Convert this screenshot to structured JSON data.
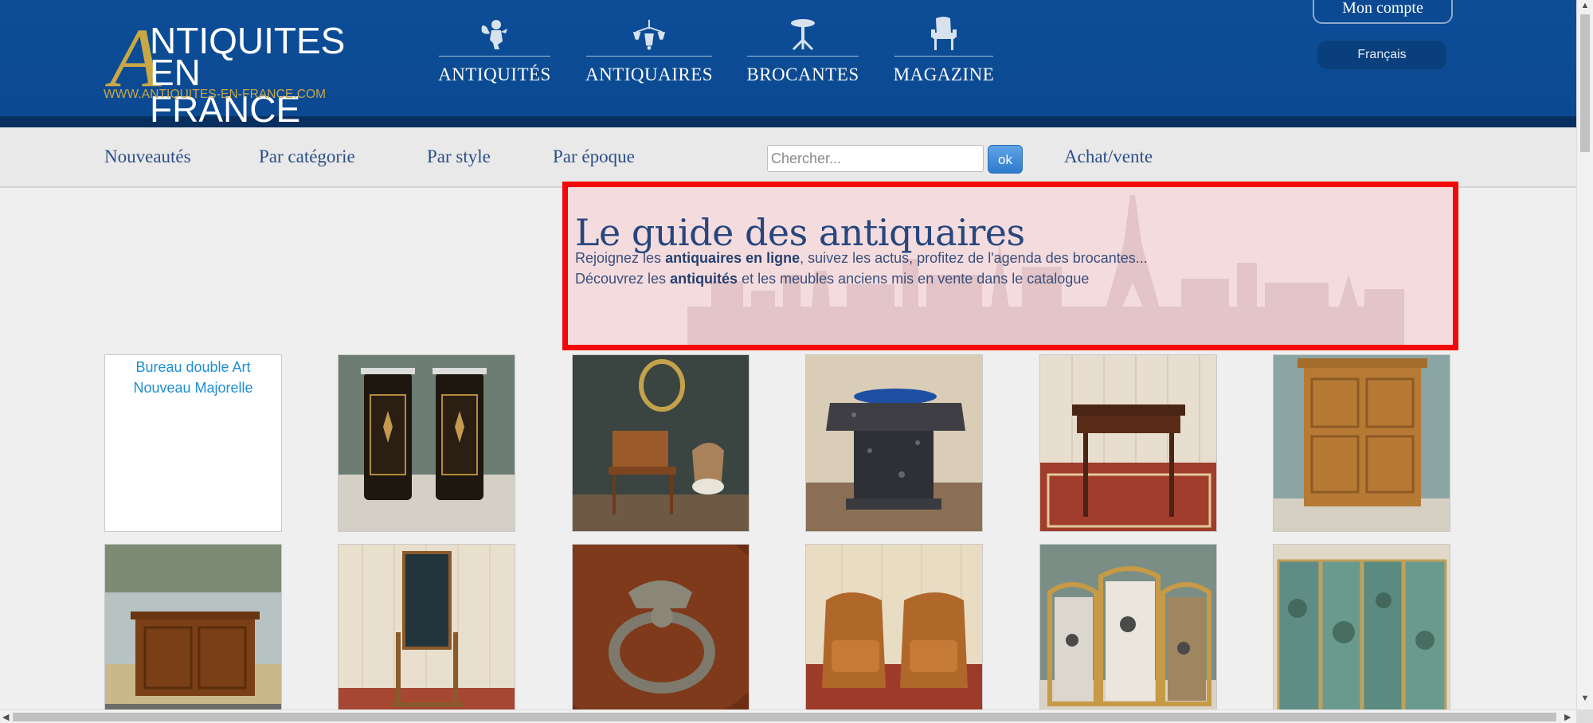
{
  "header": {
    "logo": {
      "line1": "NTIQUITES",
      "letter": "A",
      "line2": "EN FRANCE",
      "url": "WWW.ANTIQUITES-EN-FRANCE.COM"
    },
    "main_nav": [
      {
        "label": "ANTIQUITÉS",
        "icon": "cherub-icon"
      },
      {
        "label": "ANTIQUAIRES",
        "icon": "chandelier-icon"
      },
      {
        "label": "BROCANTES",
        "icon": "gueridon-table-icon"
      },
      {
        "label": "MAGAZINE",
        "icon": "armchair-icon"
      }
    ],
    "account_label": "Mon compte",
    "language": "Français"
  },
  "subnav": {
    "links": [
      "Nouveautés",
      "Par catégorie",
      "Par style",
      "Par époque"
    ],
    "search_placeholder": "Chercher...",
    "search_button": "ok",
    "achat_vente": "Achat/vente"
  },
  "hero": {
    "title": "Le guide des antiquaires",
    "line1_pre": "Rejoignez les ",
    "line1_bold": "antiquaires en ligne",
    "line1_post": ", suivez les actus, profitez de l'agenda des brocantes...",
    "line2_pre": "Découvrez les ",
    "line2_bold": "antiquités",
    "line2_post": " et les meubles anciens mis en vente dans le catalogue",
    "highlight_color": "#f20808"
  },
  "products": [
    {
      "alt": "Bureau double Art Nouveau Majorelle",
      "broken": true
    },
    {
      "subject": "pair of napoleon III marquetry cabinets"
    },
    {
      "subject": "lady's writing desk with chair"
    },
    {
      "subject": "marble pedestal table"
    },
    {
      "subject": "mahogany side table"
    },
    {
      "subject": "wooden armoire"
    },
    {
      "subject": "walnut buffet"
    },
    {
      "subject": "cheval psyche mirror"
    },
    {
      "subject": "bronze ring handle"
    },
    {
      "subject": "pair of leather club armchairs"
    },
    {
      "subject": "gilt three-panel fire screen"
    },
    {
      "subject": "painted folding screen"
    }
  ],
  "colors": {
    "header_blue": "#0b4a92",
    "gold": "#c9a745",
    "link_blue": "#2c4f87"
  }
}
